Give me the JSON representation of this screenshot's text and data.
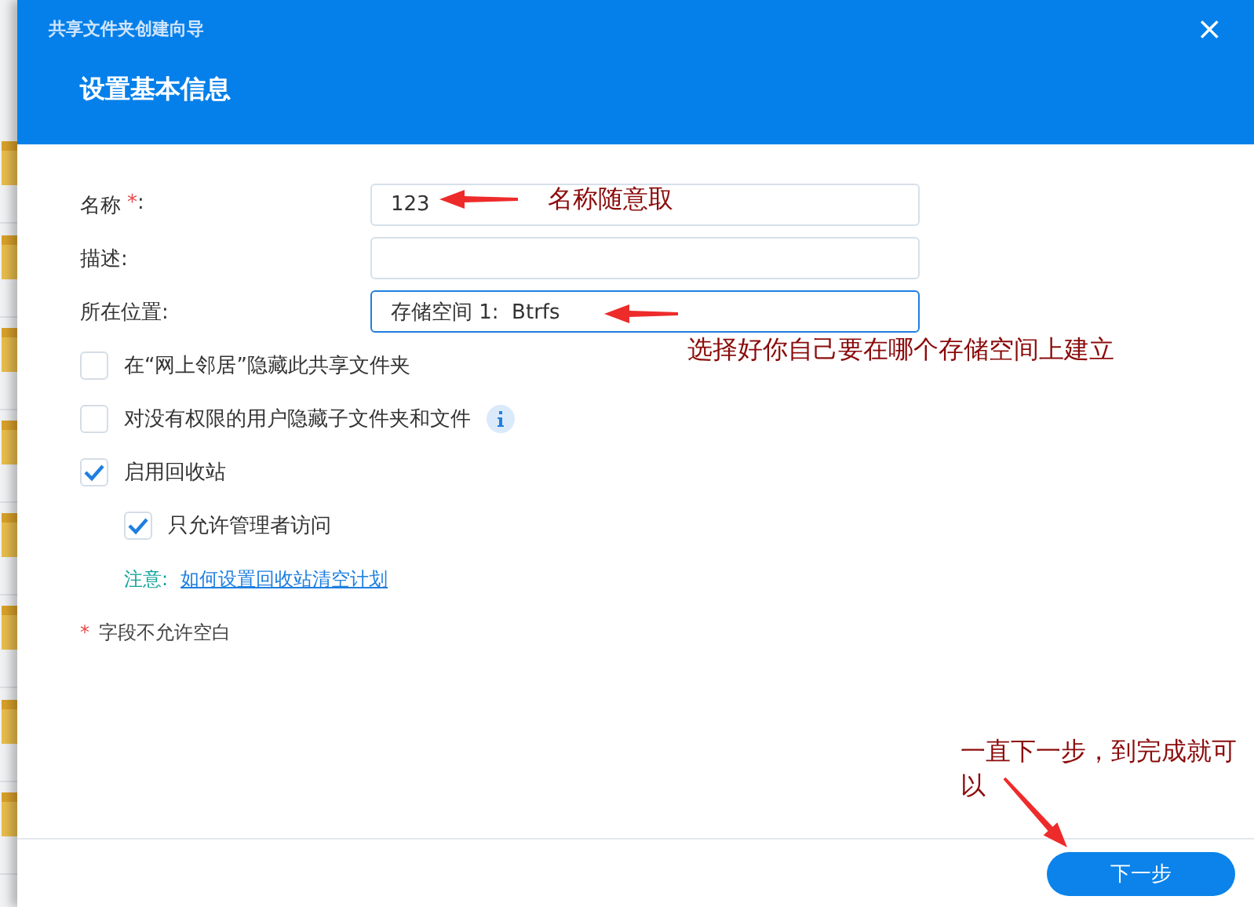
{
  "window": {
    "title": "共享文件夹创建向导",
    "close": "×"
  },
  "heading": "设置基本信息",
  "fields": [
    {
      "label": "名称",
      "required_mark": "*",
      "label_end": ":",
      "value": "123",
      "focused": false
    },
    {
      "label": "描述:",
      "focused": false
    },
    {
      "label": "所在位置:",
      "value": "存储空间 1:  Btrfs",
      "focused": true
    }
  ],
  "options": [
    {
      "label": "在“网上邻居”隐藏此共享文件夹",
      "checked": false,
      "info_icon": false
    },
    {
      "label": "对没有权限的用户隐藏子文件夹和文件",
      "checked": false,
      "info_icon": true
    },
    {
      "label": "启用回收站",
      "checked": true,
      "info_icon": false,
      "children": [
        {
          "label": "只允许管理者访问",
          "checked": true,
          "info_icon": false
        }
      ]
    }
  ],
  "note": {
    "label": "注意:",
    "link": "如何设置回收站清空计划"
  },
  "footnote": {
    "mark": "*",
    "text": "字段不允许空白"
  },
  "buttons": [
    {
      "label": "下一步"
    }
  ],
  "annotations": [
    {
      "text": "名称随意取"
    },
    {
      "text": "选择好你自己要在哪个存储空间上建立"
    },
    {
      "text": "一直下一步，到完成就可以"
    }
  ]
}
